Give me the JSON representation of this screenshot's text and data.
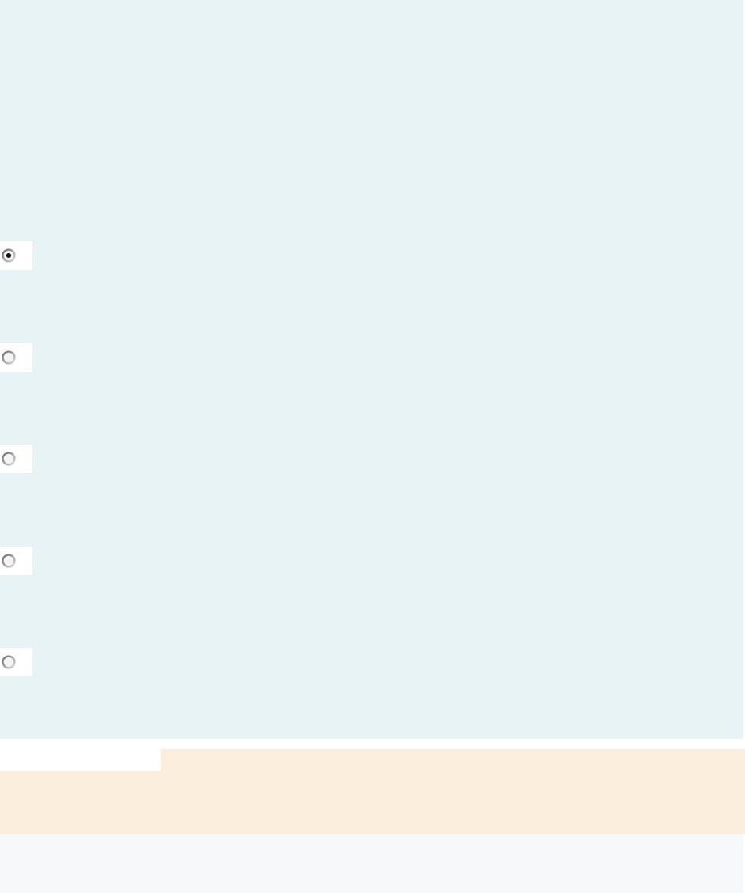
{
  "options": [
    {
      "selected": true
    },
    {
      "selected": false
    },
    {
      "selected": false
    },
    {
      "selected": false
    },
    {
      "selected": false
    }
  ]
}
